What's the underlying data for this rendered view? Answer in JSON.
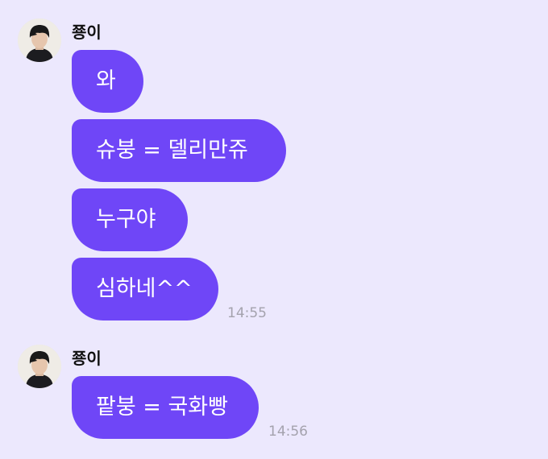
{
  "chat": {
    "groups": [
      {
        "sender": "쭁이",
        "avatar_icon": "profile-photo",
        "messages": [
          "와",
          "슈붕 = 델리만쥬",
          "누구야",
          "심하네^^"
        ],
        "time": "14:55"
      },
      {
        "sender": "쭁이",
        "avatar_icon": "profile-photo",
        "messages": [
          "팥붕 = 국화빵"
        ],
        "time": "14:56"
      }
    ]
  },
  "colors": {
    "background": "#ece8fd",
    "bubble": "#6f46f7",
    "bubble_text": "#ffffff",
    "timestamp": "#a4a2ad",
    "sender_name": "#111111"
  }
}
